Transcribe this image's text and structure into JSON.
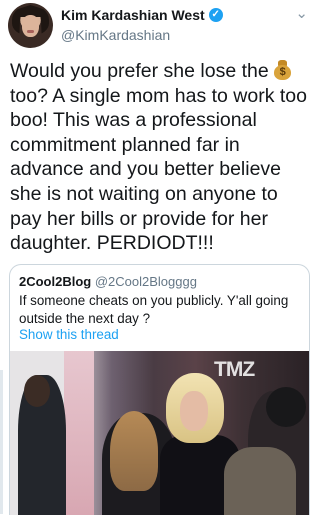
{
  "author": {
    "name": "Kim Kardashian West",
    "handle": "@KimKardashian",
    "verified_icon": "verified-badge-icon"
  },
  "tweet": {
    "text_part1": "Would you prefer she lose the",
    "emoji": "money-bag",
    "text_part2": "too? A single mom has to work too boo! This was a professional commitment planned far in advance and you better believe she is not waiting on anyone to pay her bills or provide for her daughter. PERDIODT!!!"
  },
  "quoted_tweet": {
    "name": "2Cool2Blog",
    "handle": "@2Cool2Blogggg",
    "text": "If someone cheats on you publicly. Y'all going outside the next day ?",
    "show_thread": "Show this thread",
    "watermark": "TMZ"
  },
  "colors": {
    "link_blue": "#1da1f2",
    "secondary_text": "#657786",
    "border": "#ccd6dd"
  }
}
